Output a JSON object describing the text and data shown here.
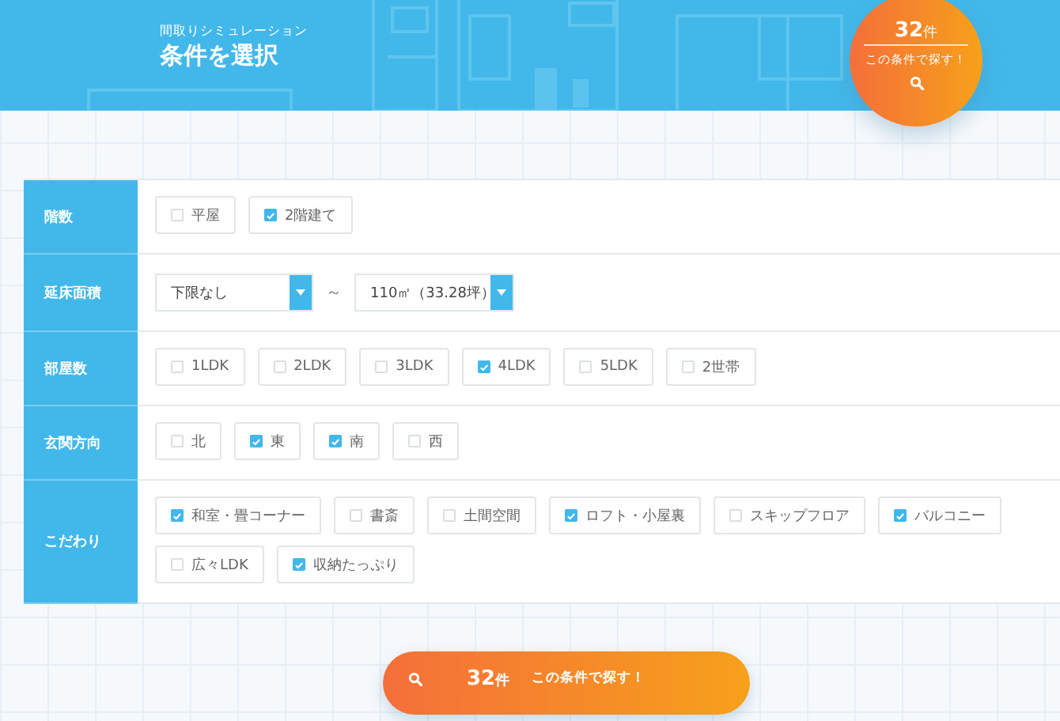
{
  "header": {
    "subtitle": "間取りシミュレーション",
    "title": "条件を選択"
  },
  "badge_button": {
    "count": "32",
    "unit": "件",
    "label": "この条件で探す！"
  },
  "rows": [
    {
      "label": "階数",
      "kind": "checkboxes",
      "options": [
        {
          "label": "平屋",
          "checked": false
        },
        {
          "label": "2階建て",
          "checked": true
        }
      ]
    },
    {
      "label": "延床面積",
      "kind": "range",
      "min": {
        "value": "下限なし"
      },
      "separator": "～",
      "max": {
        "value": "110㎡（33.28坪）"
      }
    },
    {
      "label": "部屋数",
      "kind": "checkboxes",
      "options": [
        {
          "label": "1LDK",
          "checked": false
        },
        {
          "label": "2LDK",
          "checked": false
        },
        {
          "label": "3LDK",
          "checked": false
        },
        {
          "label": "4LDK",
          "checked": true
        },
        {
          "label": "5LDK",
          "checked": false
        },
        {
          "label": "2世帯",
          "checked": false
        }
      ]
    },
    {
      "label": "玄関方向",
      "kind": "checkboxes",
      "options": [
        {
          "label": "北",
          "checked": false
        },
        {
          "label": "東",
          "checked": true
        },
        {
          "label": "南",
          "checked": true
        },
        {
          "label": "西",
          "checked": false
        }
      ]
    },
    {
      "label": "こだわり",
      "kind": "checkboxes",
      "options": [
        {
          "label": "和室・畳コーナー",
          "checked": true
        },
        {
          "label": "書斎",
          "checked": false
        },
        {
          "label": "土間空間",
          "checked": false
        },
        {
          "label": "ロフト・小屋裏",
          "checked": true
        },
        {
          "label": "スキップフロア",
          "checked": false
        },
        {
          "label": "バルコニー",
          "checked": true
        },
        {
          "label": "広々LDK",
          "checked": false
        },
        {
          "label": "収納たっぷり",
          "checked": true
        }
      ]
    }
  ],
  "search_button": {
    "count": "32",
    "unit": "件",
    "label": "この条件で探す！"
  }
}
